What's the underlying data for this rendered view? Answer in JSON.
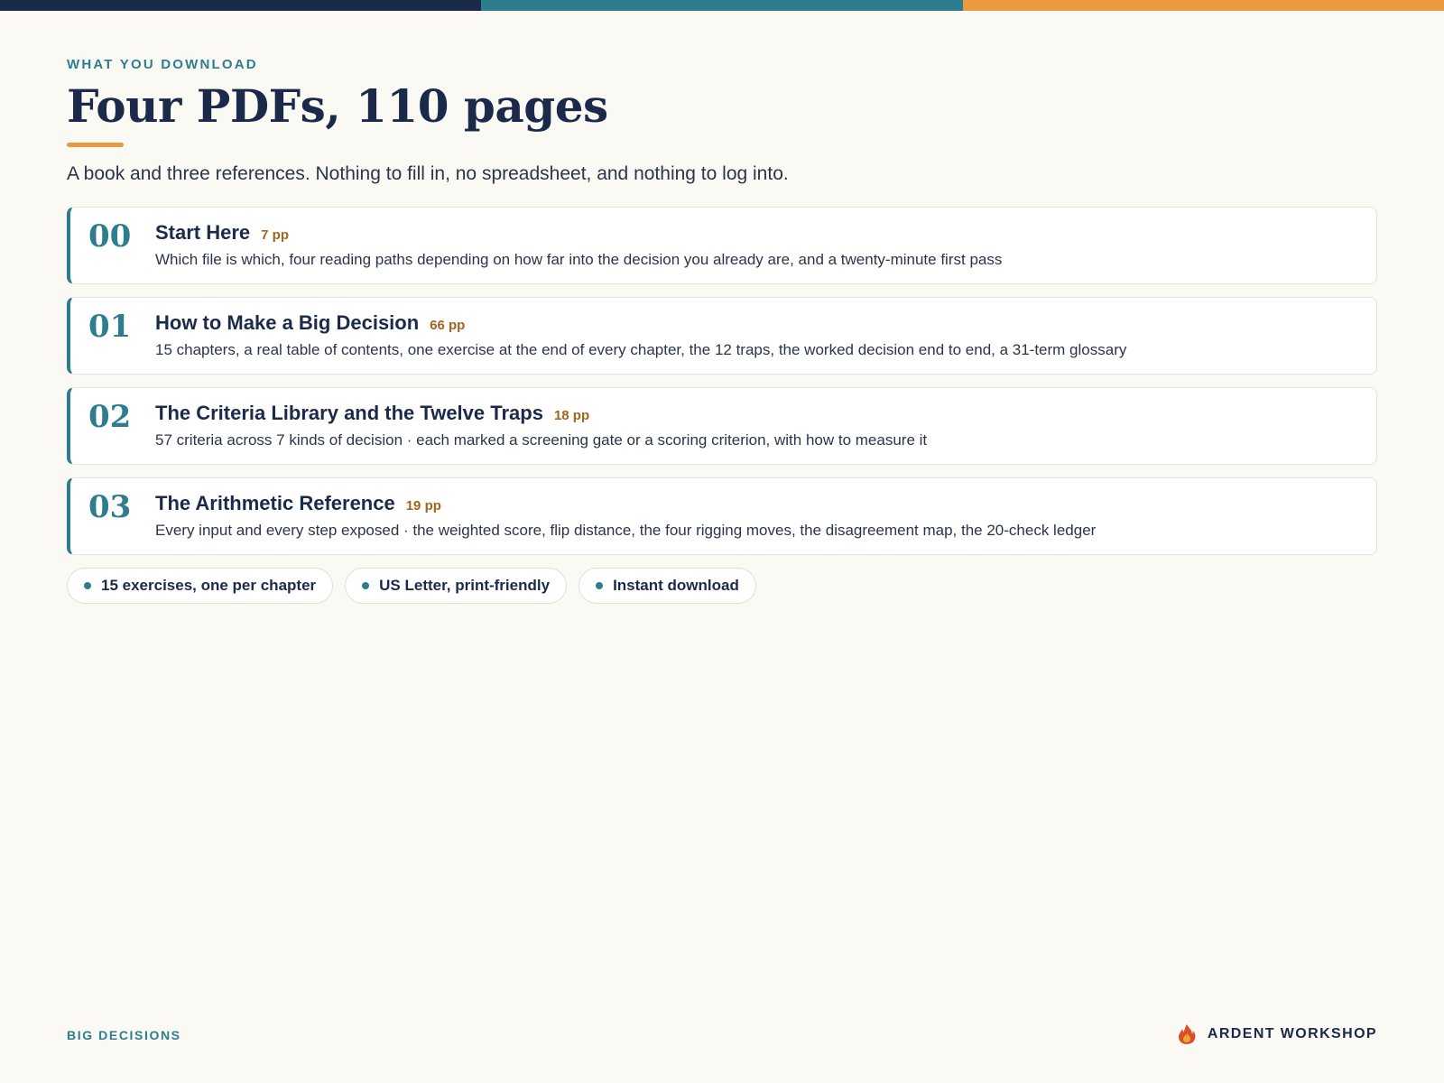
{
  "colors": {
    "navy": "#1b2a4a",
    "teal": "#2e7d8f",
    "orange": "#e9993f",
    "pages_accent": "#a0661b",
    "background": "#faf9f4"
  },
  "eyebrow": "WHAT YOU DOWNLOAD",
  "title": "Four PDFs, 110 pages",
  "subtitle": "A book and three references. Nothing to fill in, no spreadsheet, and nothing to log into.",
  "documents": [
    {
      "number": "00",
      "title": "Start Here",
      "pages": "7 pp",
      "description": "Which file is which, four reading paths depending on how far into the decision you already are, and a twenty-minute first pass"
    },
    {
      "number": "01",
      "title": "How to Make a Big Decision",
      "pages": "66 pp",
      "description": "15 chapters, a real table of contents, one exercise at the end of every chapter, the 12 traps, the worked decision end to end, a 31-term glossary"
    },
    {
      "number": "02",
      "title": "The Criteria Library and the Twelve Traps",
      "pages": "18 pp",
      "description": "57 criteria across 7 kinds of decision · each marked a screening gate or a scoring criterion, with how to measure it"
    },
    {
      "number": "03",
      "title": "The Arithmetic Reference",
      "pages": "19 pp",
      "description": "Every input and every step exposed · the weighted score, flip distance, the four rigging moves, the disagreement map, the 20-check ledger"
    }
  ],
  "features": [
    "15 exercises, one per chapter",
    "US Letter, print-friendly",
    "Instant download"
  ],
  "footer": {
    "left": "BIG DECISIONS",
    "brand": "ARDENT WORKSHOP",
    "brand_icon": "flame-icon"
  }
}
